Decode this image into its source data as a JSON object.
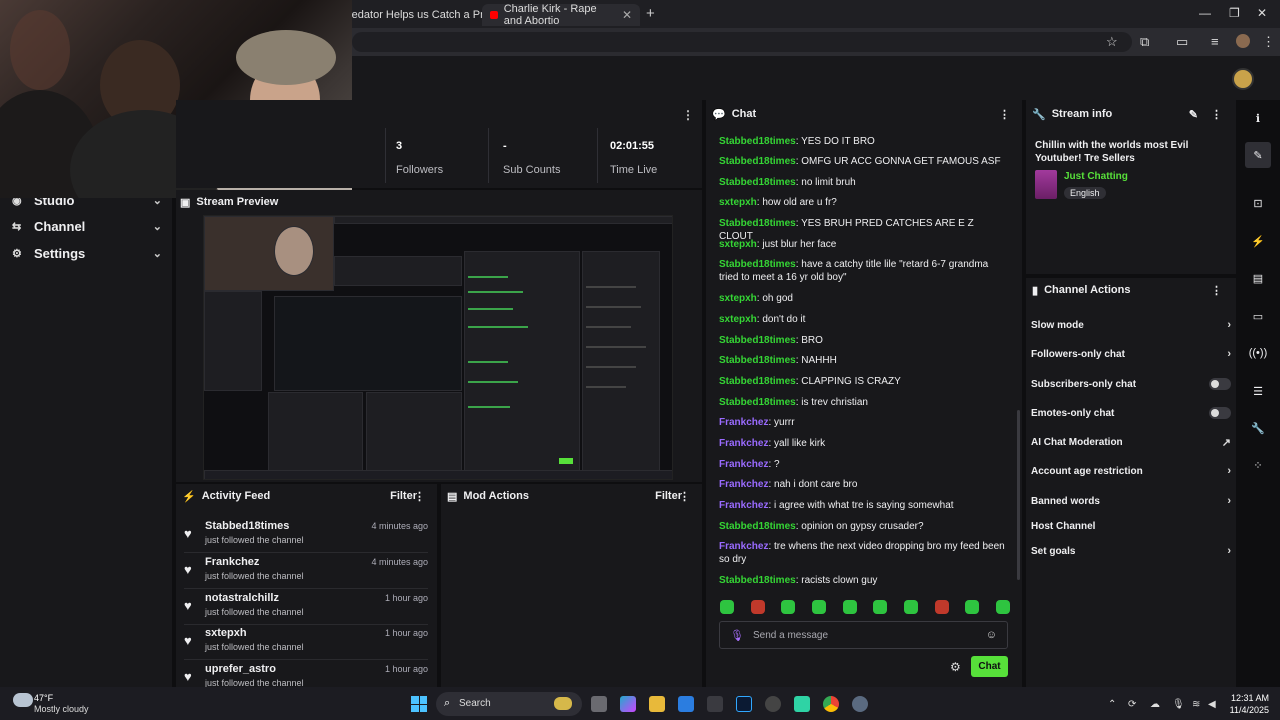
{
  "browser": {
    "tabs": [
      {
        "title": "redator Helps us Catch a Pred"
      },
      {
        "title": "Charlie Kirk - Rape and Abortio"
      }
    ],
    "brand_color": "#9146ff"
  },
  "nav": {
    "items": [
      {
        "label": "Studio"
      },
      {
        "label": "Channel"
      },
      {
        "label": "Settings"
      }
    ]
  },
  "stats": [
    {
      "value": "3",
      "label": "Followers"
    },
    {
      "value": "-",
      "label": "Sub Counts"
    },
    {
      "value": "02:01:55",
      "label": "Time Live"
    }
  ],
  "preview": {
    "title": "Stream Preview"
  },
  "activity": {
    "title": "Activity Feed",
    "filter": "Filter",
    "items": [
      {
        "name": "Stabbed18times",
        "sub": "just followed the channel",
        "time": "4 minutes ago"
      },
      {
        "name": "Frankchez",
        "sub": "just followed the channel",
        "time": "4 minutes ago"
      },
      {
        "name": "notastralchillz",
        "sub": "just followed the channel",
        "time": "1 hour ago"
      },
      {
        "name": "sxtepxh",
        "sub": "just followed the channel",
        "time": "1 hour ago"
      },
      {
        "name": "uprefer_astro",
        "sub": "just followed the channel",
        "time": "1 hour ago"
      }
    ]
  },
  "mod_actions": {
    "title": "Mod Actions",
    "filter": "Filter"
  },
  "chat": {
    "title": "Chat",
    "messages": [
      {
        "user": "Stabbed18times",
        "color": "green",
        "text": "YES DO IT BRO"
      },
      {
        "user": "Stabbed18times",
        "color": "green",
        "text": "OMFG UR ACC GONNA GET FAMOUS ASF"
      },
      {
        "user": "Stabbed18times",
        "color": "green",
        "text": "no limit bruh"
      },
      {
        "user": "sxtepxh",
        "color": "green",
        "text": "how old are u fr?"
      },
      {
        "user": "Stabbed18times",
        "color": "green",
        "text": "YES BRUH PRED CATCHES ARE E Z CLOUT"
      },
      {
        "user": "sxtepxh",
        "color": "green",
        "text": "just blur her face"
      },
      {
        "user": "Stabbed18times",
        "color": "green",
        "text": "have a catchy title lile \"retard 6-7 grandma tried to meet a 16 yr old boy\""
      },
      {
        "user": "sxtepxh",
        "color": "green",
        "text": "oh god"
      },
      {
        "user": "sxtepxh",
        "color": "green",
        "text": "don't do it"
      },
      {
        "user": "Stabbed18times",
        "color": "green",
        "text": "BRO"
      },
      {
        "user": "Stabbed18times",
        "color": "green",
        "text": "NAHHH"
      },
      {
        "user": "Stabbed18times",
        "color": "green",
        "text": "CLAPPING IS CRAZY"
      },
      {
        "user": "Stabbed18times",
        "color": "green",
        "text": "is trev christian"
      },
      {
        "user": "Frankchez",
        "color": "purple",
        "text": "yurrr"
      },
      {
        "user": "Frankchez",
        "color": "purple",
        "text": "yall like kirk"
      },
      {
        "user": "Frankchez",
        "color": "purple",
        "text": "?"
      },
      {
        "user": "Frankchez",
        "color": "purple",
        "text": "nah i dont care bro"
      },
      {
        "user": "Frankchez",
        "color": "purple",
        "text": "i agree with what tre is saying somewhat"
      },
      {
        "user": "Stabbed18times",
        "color": "green",
        "text": "opinion on gypsy crusader?"
      },
      {
        "user": "Frankchez",
        "color": "purple",
        "text": "tre whens the next video dropping bro my feed been so dry"
      },
      {
        "user": "Stabbed18times",
        "color": "green",
        "text": "racists clown guy"
      }
    ],
    "input_placeholder": "Send a message",
    "send_label": "Chat"
  },
  "stream_info": {
    "title": "Stream info",
    "stream_title": "Chillin with the worlds most Evil Youtuber! Tre Sellers",
    "category": "Just Chatting",
    "language": "English"
  },
  "channel_actions": {
    "title": "Channel Actions",
    "items": [
      {
        "label": "Slow mode",
        "control": "chevron"
      },
      {
        "label": "Followers-only chat",
        "control": "chevron"
      },
      {
        "label": "Subscribers-only chat",
        "control": "toggle"
      },
      {
        "label": "Emotes-only chat",
        "control": "toggle"
      },
      {
        "label": "AI Chat Moderation",
        "control": "external"
      },
      {
        "label": "Account age restriction",
        "control": "chevron"
      },
      {
        "label": "Banned words",
        "control": "chevron"
      },
      {
        "label": "Host Channel",
        "control": "none"
      },
      {
        "label": "Set goals",
        "control": "chevron"
      }
    ]
  },
  "taskbar": {
    "weather_temp": "47°F",
    "weather_desc": "Mostly cloudy",
    "search": "Search",
    "time": "12:31 AM",
    "date": "11/4/2025"
  }
}
